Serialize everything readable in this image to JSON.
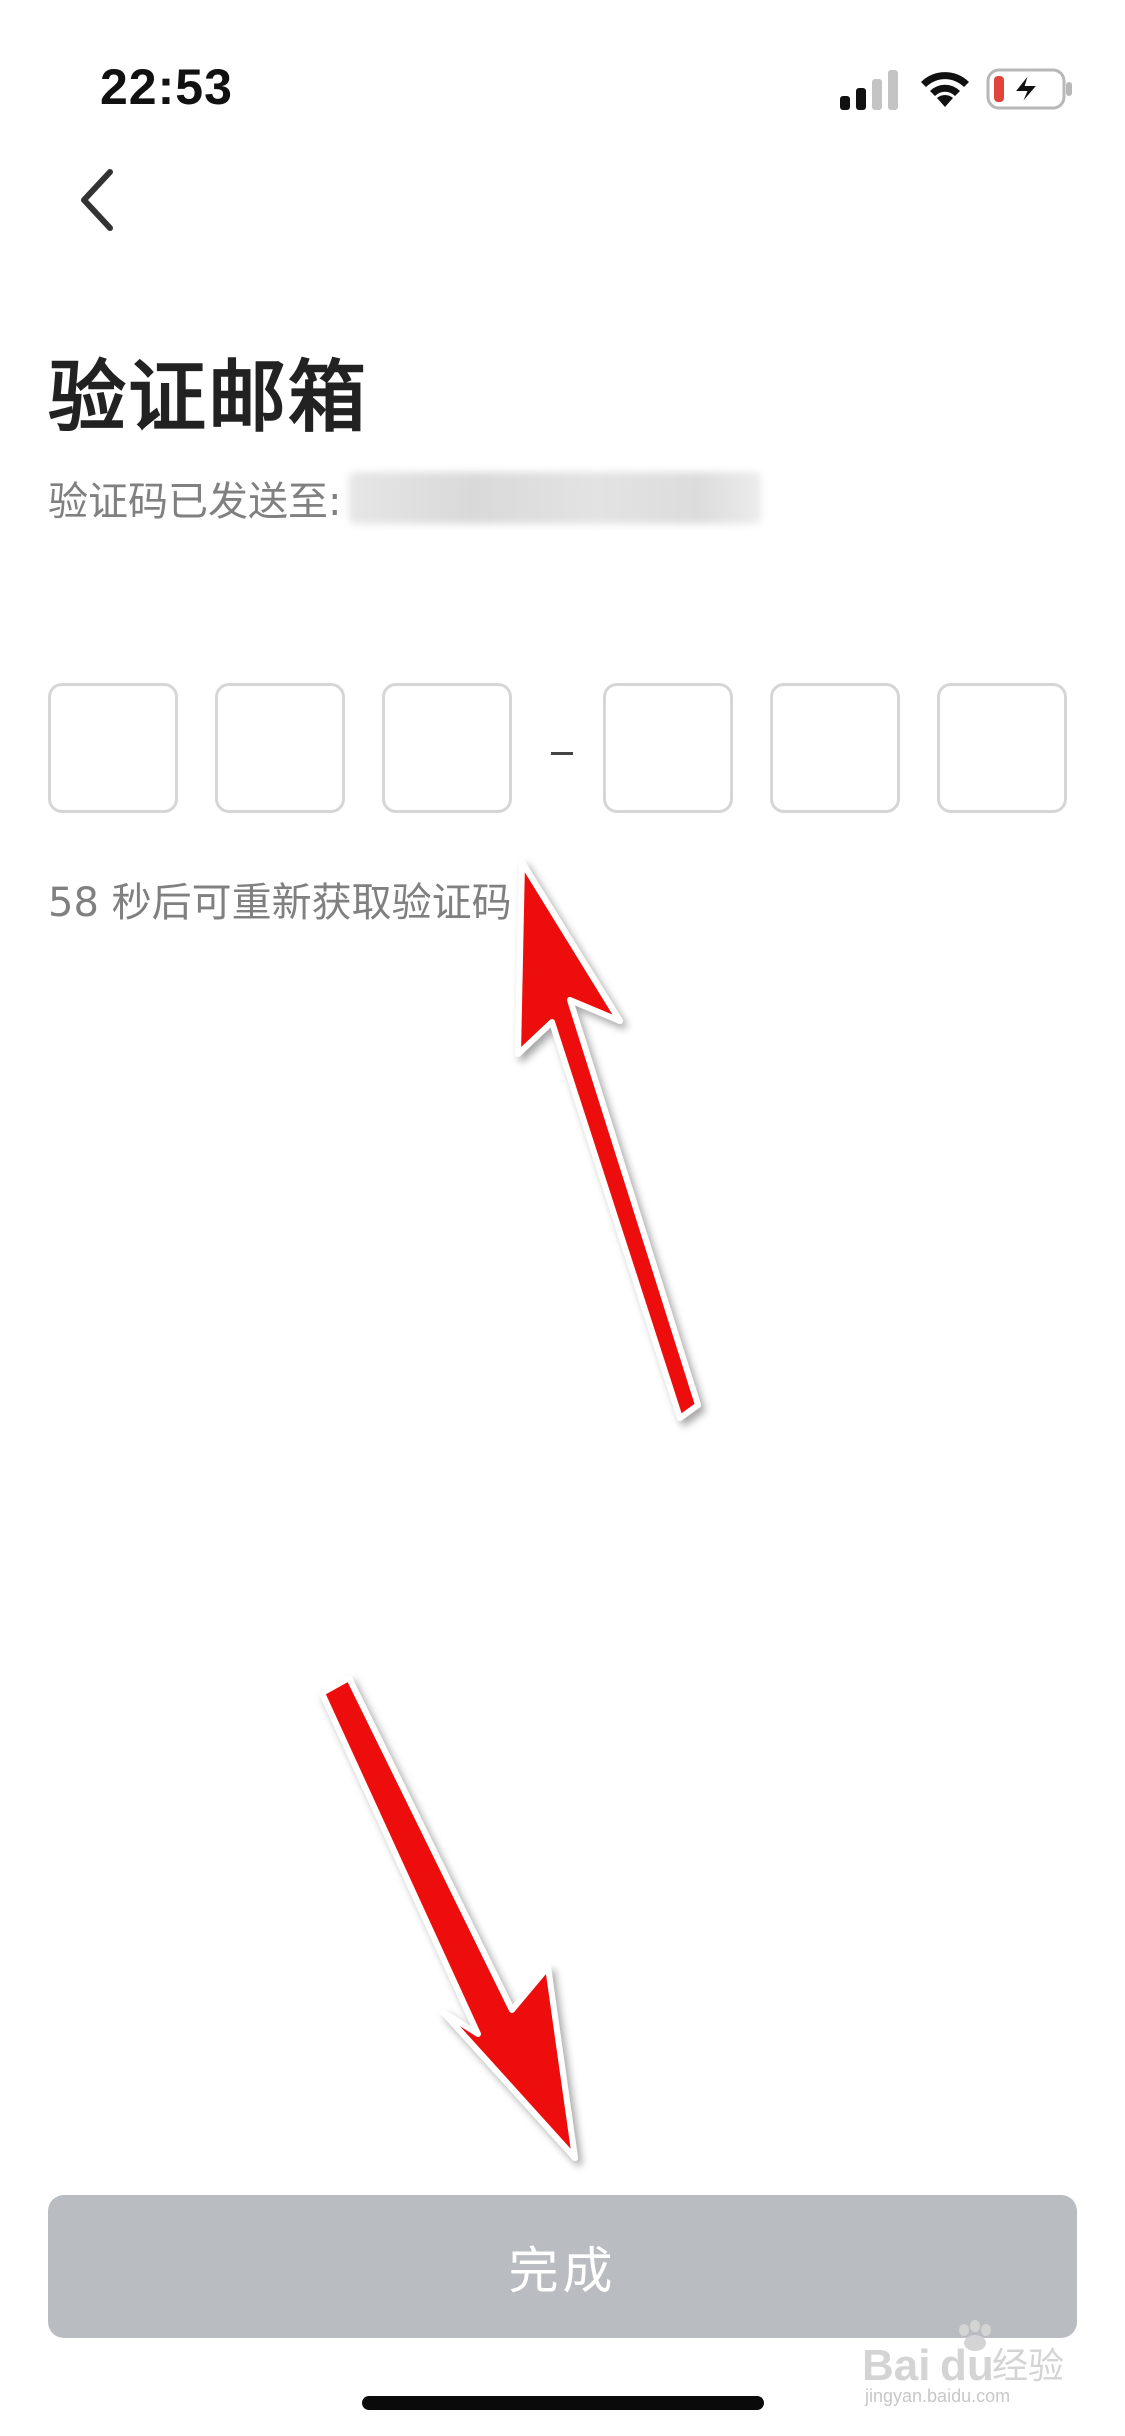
{
  "status_bar": {
    "time": "22:53",
    "icons": [
      "signal-icon",
      "wifi-icon",
      "battery-charging-icon"
    ],
    "battery_color": "#e0443a"
  },
  "nav": {
    "back_icon": "chevron-left-icon"
  },
  "page": {
    "title": "验证邮箱",
    "subtitle_prefix": "验证码已发送至:",
    "email_redacted": true
  },
  "code_input": {
    "digits": [
      "",
      "",
      "",
      "",
      "",
      ""
    ],
    "separator": "-"
  },
  "resend": {
    "text": "58 秒后可重新获取验证码"
  },
  "footer": {
    "done_label": "完成",
    "done_enabled": false,
    "button_color": "#b9bcc0"
  },
  "annotations": {
    "arrow_color": "#ee1111"
  },
  "watermark": {
    "brand": "Baidu经验",
    "url": "jingyan.baidu.com"
  }
}
